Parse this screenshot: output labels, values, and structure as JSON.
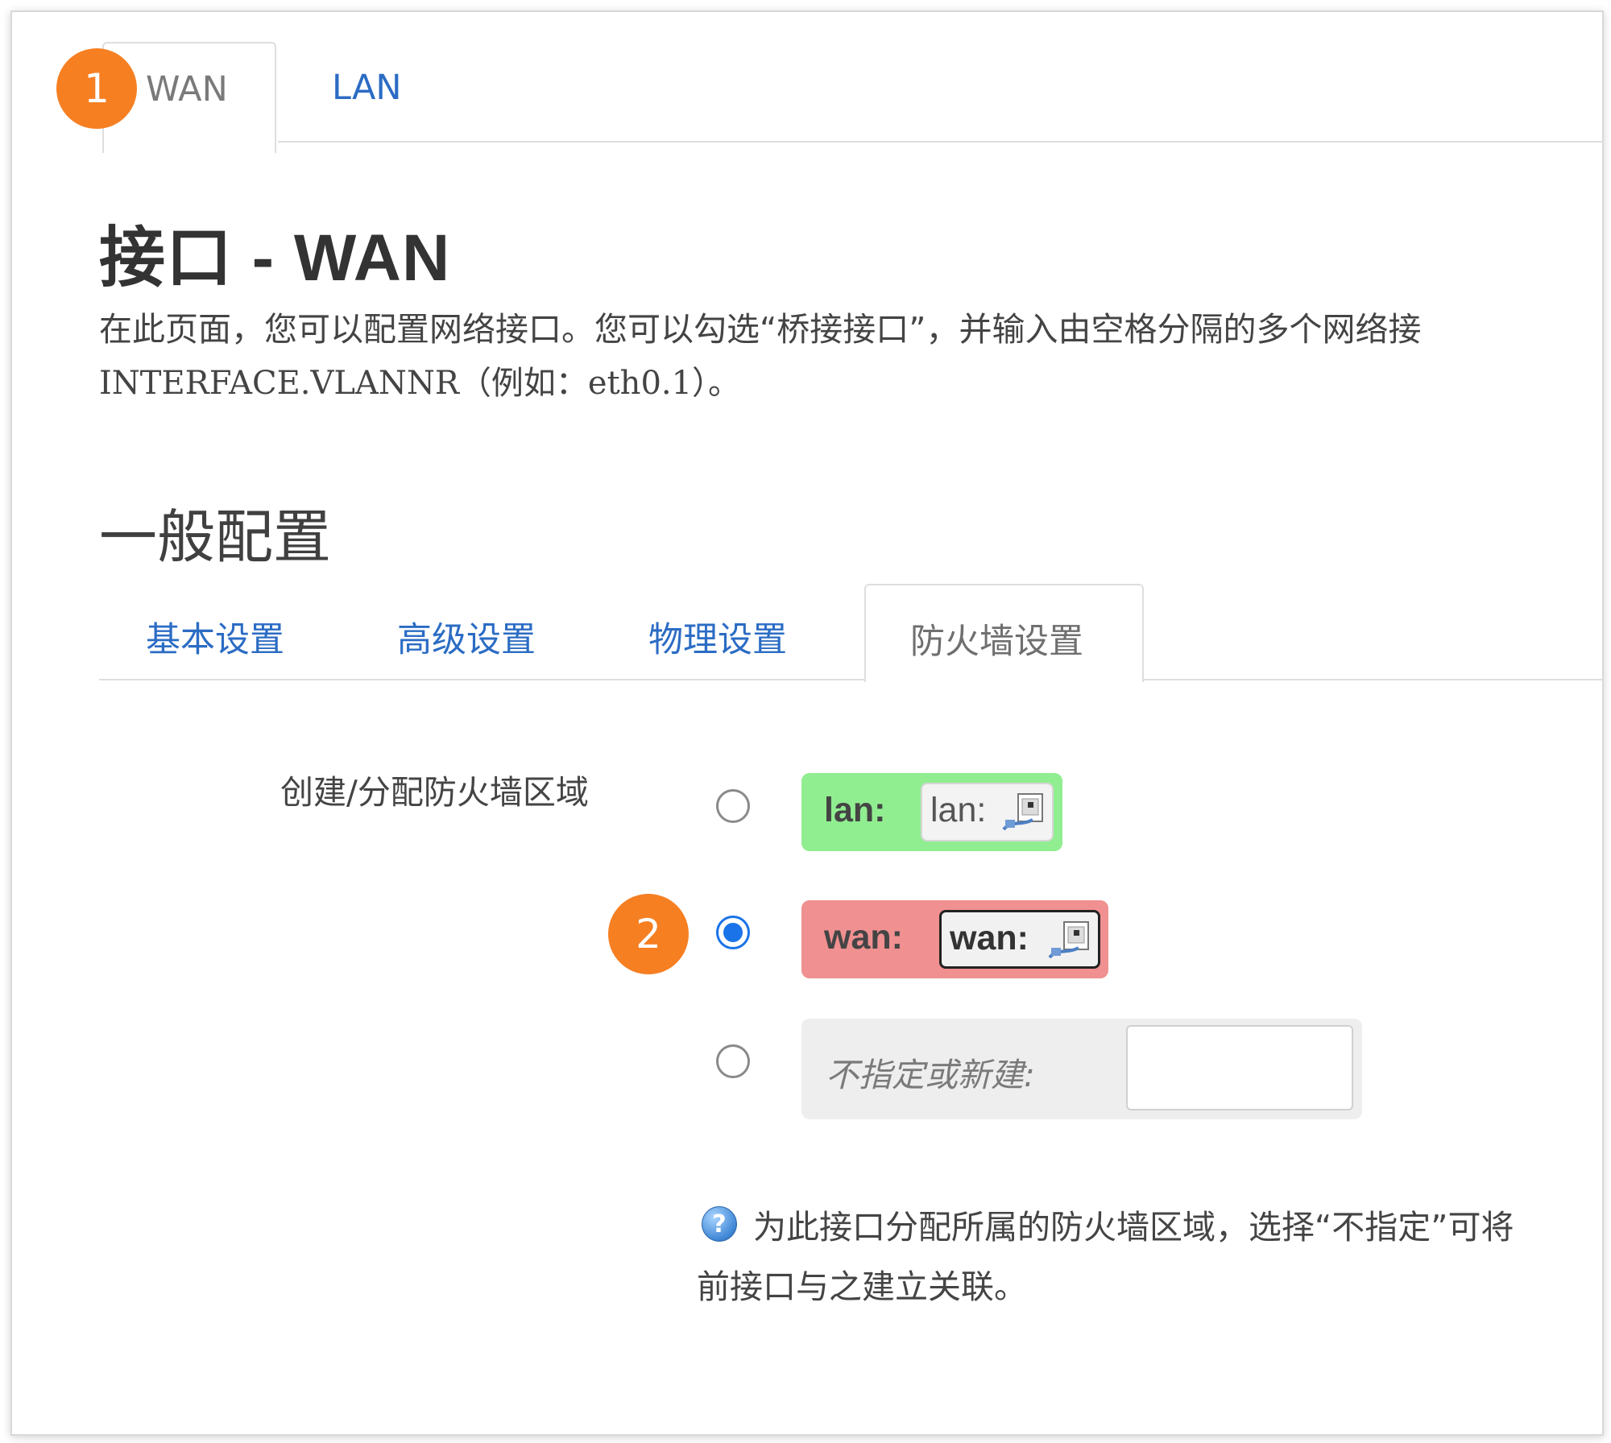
{
  "top_tabs": {
    "wan": "WAN",
    "lan": "LAN"
  },
  "badges": {
    "one": "1",
    "two": "2"
  },
  "page": {
    "title": "接口 - WAN",
    "description_line1": "在此页面，您可以配置网络接口。您可以勾选“桥接接口”，并输入由空格分隔的多个网络接",
    "description_line2": "INTERFACE.VLANNR（例如：eth0.1）。"
  },
  "section": {
    "title": "一般配置",
    "tabs": [
      "基本设置",
      "高级设置",
      "物理设置",
      "防火墙设置"
    ],
    "active_tab": "防火墙设置"
  },
  "firewall": {
    "label": "创建/分配防火墙区域",
    "options": [
      {
        "zone": "lan:",
        "chip": "lan:",
        "color": "#90ee90",
        "checked": false
      },
      {
        "zone": "wan:",
        "chip": "wan:",
        "color": "#f09090",
        "checked": true
      },
      {
        "zone": "不指定或新建:",
        "input_value": "",
        "color": "#eeeeee",
        "checked": false
      }
    ],
    "help_line1": "为此接口分配所属的防火墙区域，选择“不指定”可将",
    "help_line2": "前接口与之建立关联。"
  },
  "colors": {
    "accent_link": "#2b6cc4",
    "badge": "#f67f22",
    "radio_checked": "#1a73e8"
  },
  "icons": [
    "network-interface-icon",
    "help-icon"
  ]
}
